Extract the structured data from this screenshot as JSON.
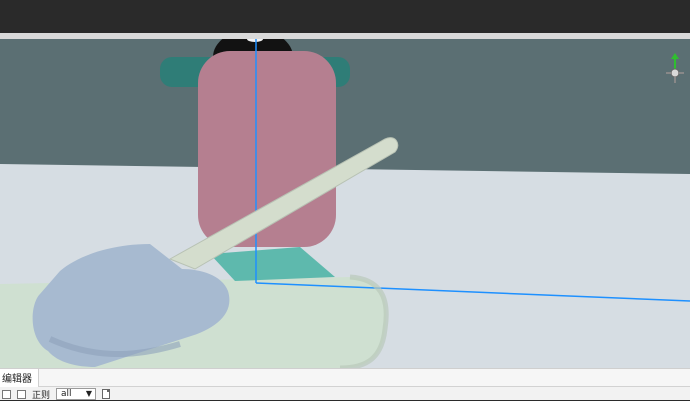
{
  "window": {
    "top_bar": "",
    "gizmo": "axis-gizmo-icon"
  },
  "scene": {
    "sky_color": "#5b6f73",
    "floor_color": "#d4dce3",
    "character_body_color": "#b57f90",
    "arm_color": "#2f7d77",
    "head_color": "#121212",
    "stick_color": "#d6dfcf",
    "base_color": "#cfe1cf",
    "blue_pad_color": "#a7bad0",
    "selection_line_color": "#1e90ff"
  },
  "panel": {
    "tab_label": "编辑器",
    "filter_label": "正则",
    "select_value": "all",
    "select_arrow": "▼"
  }
}
